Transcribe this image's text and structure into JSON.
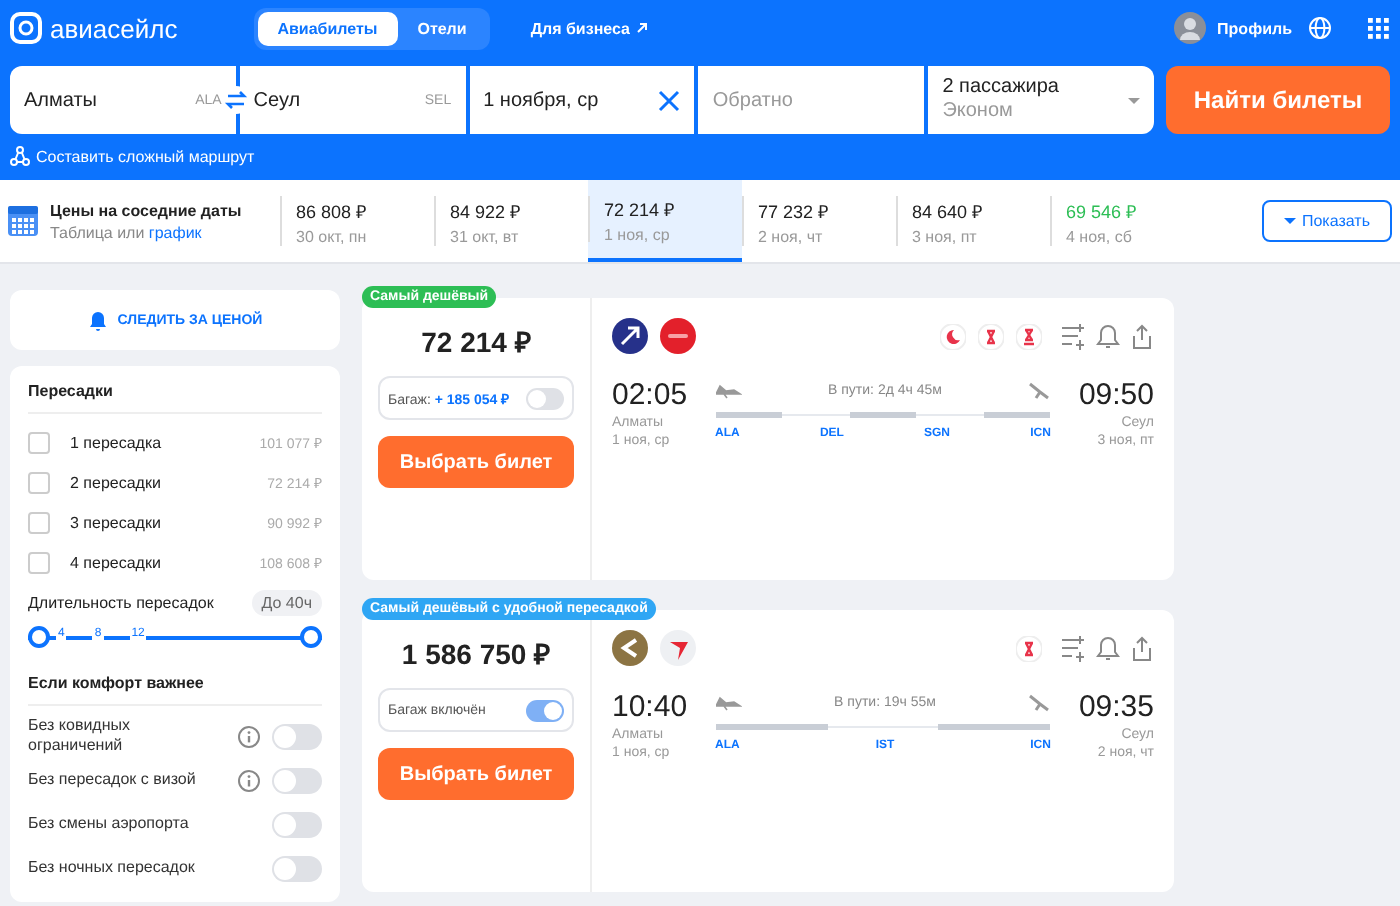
{
  "header": {
    "logo": "авиасейлс",
    "tabs": [
      {
        "label": "Авиабилеты",
        "selected": true
      },
      {
        "label": "Отели",
        "selected": false
      }
    ],
    "business_link": "Для бизнеса",
    "profile": "Профиль"
  },
  "search": {
    "from": {
      "value": "Алматы",
      "code": "ALA"
    },
    "to": {
      "value": "Сеул",
      "code": "SEL"
    },
    "depart": {
      "value": "1 ноября, ср"
    },
    "return": {
      "placeholder": "Обратно"
    },
    "passengers": {
      "value": "2 пассажира",
      "class": "Эконом"
    },
    "submit": "Найти билеты",
    "complex_route": "Составить сложный маршрут"
  },
  "date_strip": {
    "title": "Цены на соседние даты",
    "subtitle": "Таблица или",
    "subtitle_link": "график",
    "dates": [
      {
        "price": "86 808 ₽",
        "date": "30 окт, пн",
        "selected": false,
        "cheapest": false
      },
      {
        "price": "84 922 ₽",
        "date": "31 окт, вт",
        "selected": false,
        "cheapest": false
      },
      {
        "price": "72 214 ₽",
        "date": "1 ноя, ср",
        "selected": true,
        "cheapest": false
      },
      {
        "price": "77 232 ₽",
        "date": "2 ноя, чт",
        "selected": false,
        "cheapest": false
      },
      {
        "price": "84 640 ₽",
        "date": "3 ноя, пт",
        "selected": false,
        "cheapest": false
      },
      {
        "price": "69 546 ₽",
        "date": "4 ноя, сб",
        "selected": false,
        "cheapest": true
      }
    ],
    "show_button": "Показать"
  },
  "sidebar": {
    "track_price": "СЛЕДИТЬ ЗА ЦЕНОЙ",
    "stops": {
      "title": "Пересадки",
      "options": [
        {
          "label": "1 пересадка",
          "price": "101 077 ₽",
          "checked": false
        },
        {
          "label": "2 пересадки",
          "price": "72 214 ₽",
          "checked": false
        },
        {
          "label": "3 пересадки",
          "price": "90 992 ₽",
          "checked": false
        },
        {
          "label": "4 пересадки",
          "price": "108 608 ₽",
          "checked": false
        }
      ]
    },
    "duration": {
      "title": "Длительность пересадок",
      "value": "До 40ч",
      "ticks": [
        "4",
        "8",
        "12"
      ],
      "thumbs": [
        {
          "level": 0
        },
        {
          "level": 1
        }
      ]
    },
    "comfort": {
      "title": "Если комфорт важнее",
      "options": [
        {
          "label": "Без ковидных ограничений",
          "info": true,
          "on": false
        },
        {
          "label": "Без пересадок с визой",
          "info": true,
          "on": false
        },
        {
          "label": "Без смены аэропорта",
          "info": false,
          "on": false
        },
        {
          "label": "Без ночных пересадок",
          "info": false,
          "on": false
        }
      ]
    }
  },
  "tickets": [
    {
      "badge": "Самый дешёвый",
      "color": "#2dbe55",
      "price": "72 214 ₽",
      "baggage": {
        "label": "Багаж:",
        "extra": "+ 185 054 ₽",
        "on": false
      },
      "select": "Выбрать билет",
      "airlines": [
        {
          "kind": "plane-disc"
        },
        {
          "kind": "red-disc"
        }
      ],
      "features": [
        {
          "kind": "night"
        },
        {
          "kind": "hourglass"
        },
        {
          "kind": "hourglass-alert"
        }
      ],
      "depart": {
        "time": "02:05",
        "city": "Алматы",
        "date": "1 ноя, ср"
      },
      "duration": "В пути: 2д 4ч 45м",
      "arrive": {
        "time": "09:50",
        "city": "Сеул",
        "date": "3 ноя, пт"
      },
      "route": [
        "ALA",
        "DEL",
        "SGN",
        "ICN"
      ]
    },
    {
      "badge": "Самый дешёвый с удобной пересадкой",
      "color": "#2fa6f4",
      "price": "1 586 750 ₽",
      "baggage": {
        "label": "Багаж включён",
        "on": true
      },
      "select": "Выбрать билет",
      "airlines": [
        {
          "kind": "chevron-disc"
        },
        {
          "kind": "swoosh-disc"
        }
      ],
      "features": [
        {
          "kind": "hourglass"
        }
      ],
      "depart": {
        "time": "10:40",
        "city": "Алматы",
        "date": "1 ноя, ср"
      },
      "duration": "В пути: 19ч 55м",
      "arrive": {
        "time": "09:35",
        "city": "Сеул",
        "date": "2 ноя, чт"
      },
      "route": [
        "ALA",
        "IST",
        "ICN"
      ]
    }
  ]
}
